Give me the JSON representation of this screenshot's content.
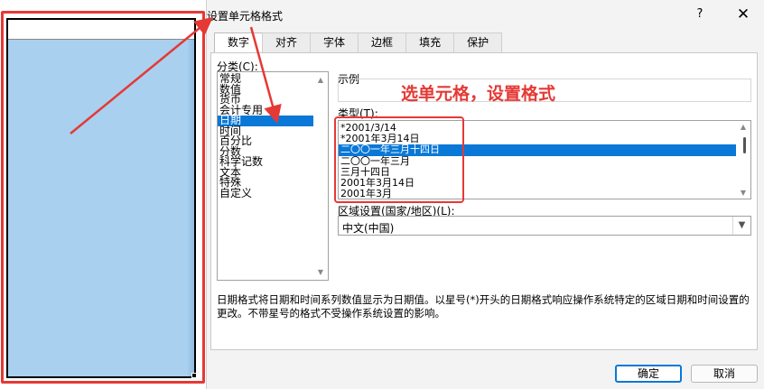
{
  "dialog": {
    "title": "设置单元格格式",
    "help_label": "?",
    "close_label": "✕",
    "tabs": [
      {
        "label": "数字",
        "active": true
      },
      {
        "label": "对齐",
        "active": false
      },
      {
        "label": "字体",
        "active": false
      },
      {
        "label": "边框",
        "active": false
      },
      {
        "label": "填充",
        "active": false
      },
      {
        "label": "保护",
        "active": false
      }
    ]
  },
  "category": {
    "label": "分类(C):",
    "items": [
      "常规",
      "数值",
      "货币",
      "会计专用",
      "日期",
      "时间",
      "百分比",
      "分数",
      "科学记数",
      "文本",
      "特殊",
      "自定义"
    ],
    "selected": "日期"
  },
  "sample": {
    "label": "示例",
    "annotation": "选单元格，设置格式"
  },
  "type": {
    "label": "类型(T):",
    "items": [
      "*2001/3/14",
      "*2001年3月14日",
      "二〇〇一年三月十四日",
      "二〇〇一年三月",
      "三月十四日",
      "2001年3月14日",
      "2001年3月"
    ],
    "selected": "二〇〇一年三月十四日"
  },
  "locale": {
    "label": "区域设置(国家/地区)(L):",
    "value": "中文(中国)"
  },
  "description": "日期格式将日期和时间系列数值显示为日期值。以星号(*)开头的日期格式响应操作系统特定的区域日期和时间设置的更改。不带星号的格式不受操作系统设置的影响。",
  "buttons": {
    "ok": "确定",
    "cancel": "取消"
  },
  "colors": {
    "accent": "#0a78d7",
    "annotation_red": "#e53935",
    "cell_fill": "#a9d0ef"
  }
}
